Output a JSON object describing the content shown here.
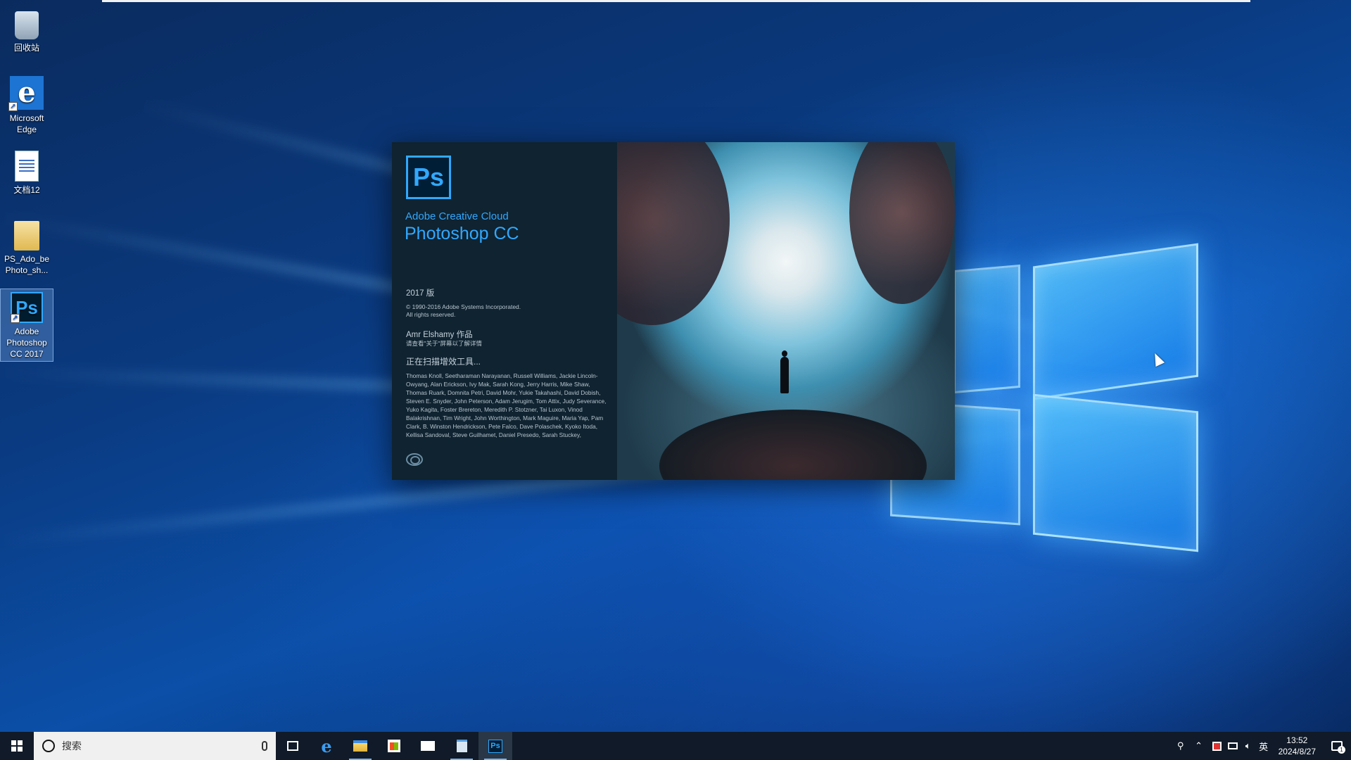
{
  "desktop": {
    "icons": [
      {
        "label": "回收站",
        "icon": "recycle-bin-icon"
      },
      {
        "label": "Microsoft Edge",
        "icon": "edge-icon"
      },
      {
        "label": "文档12",
        "icon": "document-icon"
      },
      {
        "label": "PS_Ado_be Photo_sh...",
        "icon": "folder-icon"
      },
      {
        "label": "Adobe Photoshop CC 2017",
        "icon": "photoshop-icon",
        "selected": true
      }
    ]
  },
  "splash": {
    "logo_text": "Ps",
    "cloud_line": "Adobe Creative Cloud",
    "product": "Photoshop CC",
    "version": "2017 版",
    "copyright_1": "© 1990-2016 Adobe Systems Incorporated.",
    "copyright_2": "All rights reserved.",
    "artist": "Amr Elshamy 作品",
    "artist_note": "请查看\"关于\"屏幕以了解详情",
    "status": "正在扫描增效工具...",
    "credits": "Thomas Knoll, Seetharaman Narayanan, Russell Williams, Jackie Lincoln-Owyang, Alan Erickson, Ivy Mak, Sarah Kong, Jerry Harris, Mike Shaw, Thomas Ruark, Domnita Petri, David Mohr, Yukie Takahashi, David Dobish, Steven E. Snyder, John Peterson, Adam Jerugim, Tom Attix, Judy Severance, Yuko Kagita, Foster Brereton, Meredith P. Stotzner, Tai Luxon, Vinod Balakrishnan, Tim Wright, John Worthington, Mark Maguire, Maria Yap, Pam Clark, B. Winston Hendrickson, Pete Falco, Dave Polaschek, Kyoko Itoda, Kellisa Sandoval, Steve Guilhamet, Daniel Presedo, Sarah Stuckey,"
  },
  "taskbar": {
    "search_placeholder": "搜索",
    "pinned": [
      "task-view-icon",
      "edge-icon",
      "file-explorer-icon",
      "store-icon",
      "mail-icon",
      "notepad-icon",
      "photoshop-icon"
    ],
    "photoshop_label": "Ps",
    "ime": "英",
    "time": "13:52",
    "date": "2024/8/27",
    "notification_count": "1"
  }
}
